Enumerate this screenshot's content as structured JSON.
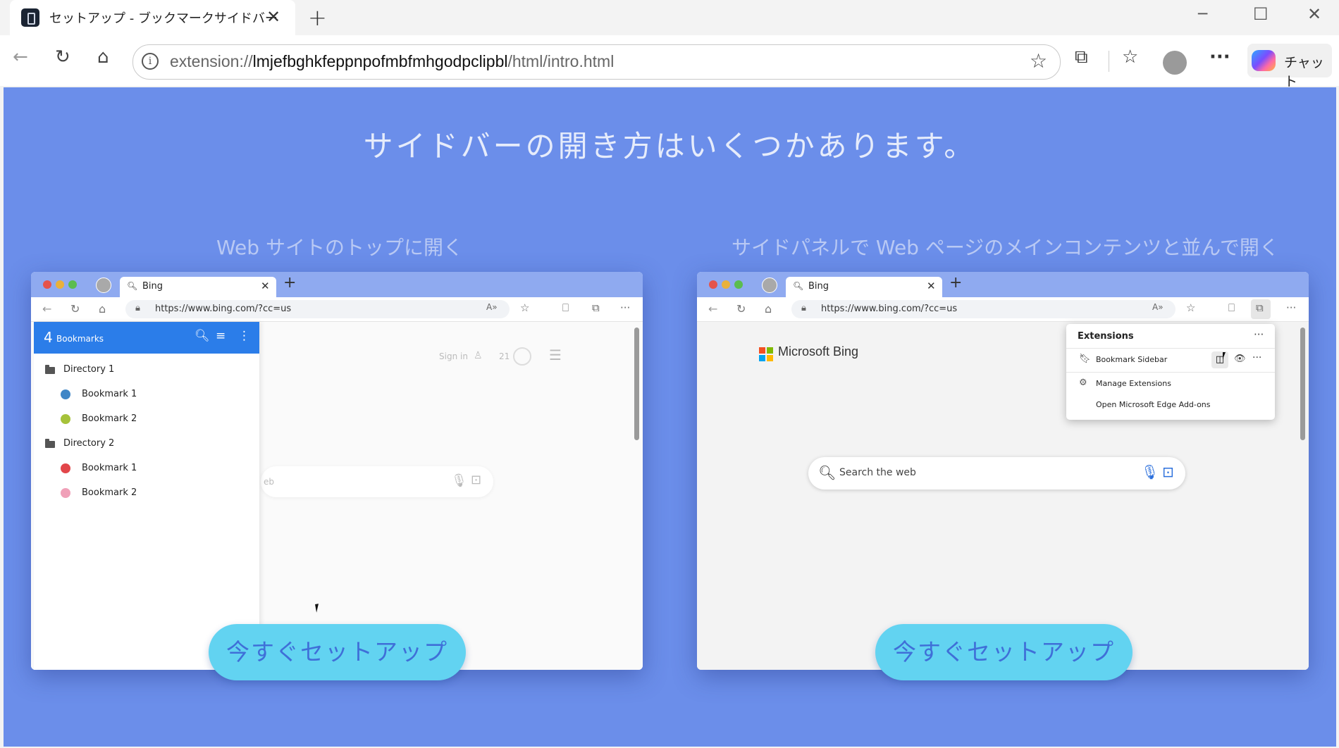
{
  "browser": {
    "tab_title": "セットアップ - ブックマークサイドバー",
    "url_prefix": "extension://",
    "url_host": "lmjefbghkfeppnpofmbfmhgodpclipbl",
    "url_path": "/html/intro.html",
    "chat_label": "チャット",
    "icons": [
      "back-icon",
      "refresh-icon",
      "home-icon",
      "info-icon",
      "star-icon",
      "extensions-icon",
      "favorites-icon",
      "profile-icon",
      "more-icon",
      "copilot-icon"
    ]
  },
  "page": {
    "headline": "サイドバーの開き方はいくつかあります。",
    "left_subtitle": "Web サイトのトップに開く",
    "right_subtitle": "サイドパネルで Web ページのメインコンテンツと並んで開く",
    "cta_label": "今すぐセットアップ",
    "colors": {
      "background": "#6b8eea",
      "cta": "#62d3f1",
      "sidebar_header": "#2b7de9"
    }
  },
  "mock": {
    "tab_title": "Bing",
    "url": "https://www.bing.com/?cc=us",
    "read_aloud": "A»"
  },
  "left_mock": {
    "bookmark_count": "4",
    "bookmarks_label": "Bookmarks",
    "bg_sign_in": "Sign in",
    "bg_points": "21",
    "bg_search_fragment": "eb",
    "tree": [
      {
        "type": "folder",
        "label": "Directory 1"
      },
      {
        "type": "bookmark",
        "label": "Bookmark 1",
        "color": "#3f86c6"
      },
      {
        "type": "bookmark",
        "label": "Bookmark 2",
        "color": "#a6c23a"
      },
      {
        "type": "folder",
        "label": "Directory 2"
      },
      {
        "type": "bookmark",
        "label": "Bookmark 1",
        "color": "#e2464a"
      },
      {
        "type": "bookmark",
        "label": "Bookmark 2",
        "color": "#f0a0b8"
      }
    ]
  },
  "right_mock": {
    "logo_text": "Microsoft Bing",
    "search_placeholder": "Search the web",
    "extensions_title": "Extensions",
    "extension_name": "Bookmark Sidebar",
    "manage_extensions": "Manage Extensions",
    "addons_link": "Open Microsoft Edge Add-ons"
  }
}
